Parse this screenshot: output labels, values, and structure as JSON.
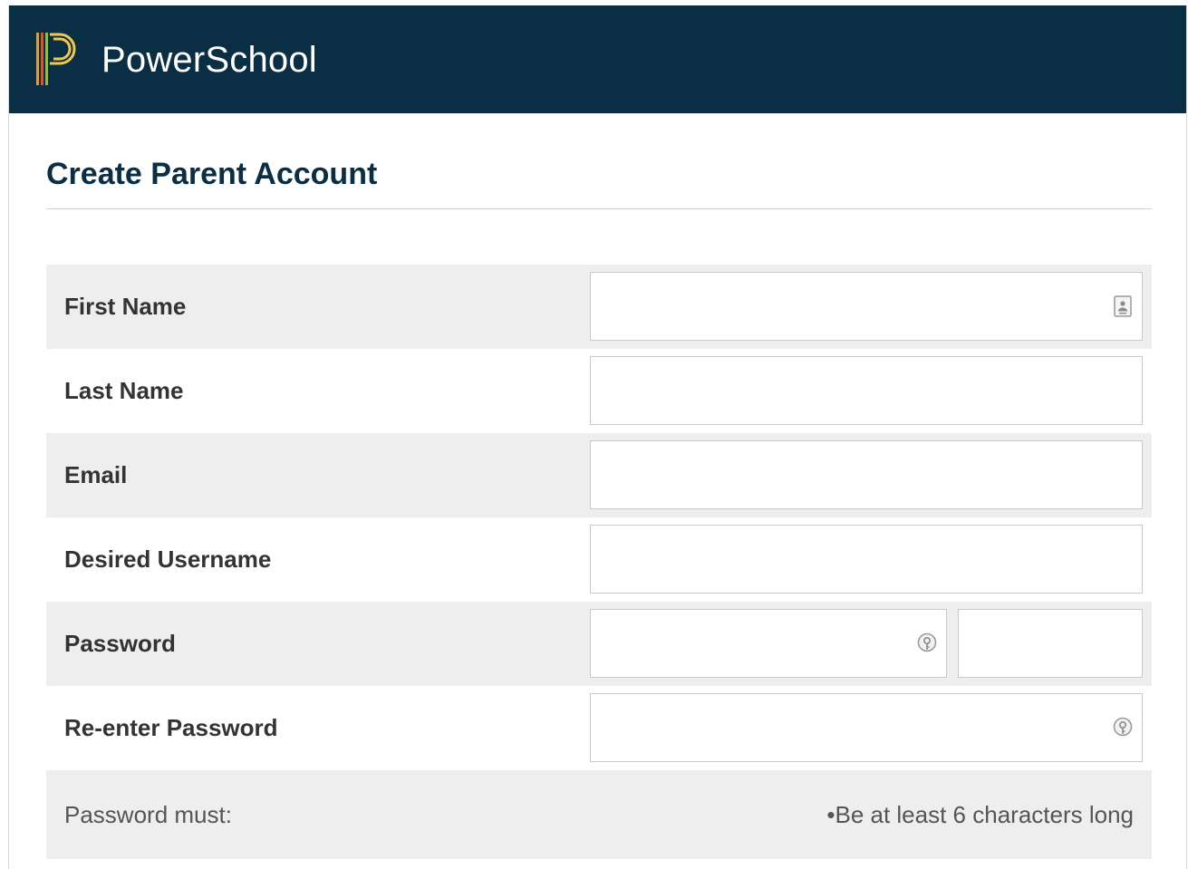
{
  "header": {
    "brand": "PowerSchool",
    "logo_icon": "powerschool-logo",
    "background_color": "#0a2f45"
  },
  "page": {
    "title": "Create Parent Account"
  },
  "form": {
    "first_name": {
      "label": "First Name",
      "value": "",
      "icon": "contact-card-icon"
    },
    "last_name": {
      "label": "Last Name",
      "value": ""
    },
    "email": {
      "label": "Email",
      "value": ""
    },
    "username": {
      "label": "Desired Username",
      "value": ""
    },
    "password": {
      "label": "Password",
      "value": "",
      "icon": "password-key-icon",
      "strength_value": ""
    },
    "reenter_password": {
      "label": "Re-enter Password",
      "value": "",
      "icon": "password-key-icon"
    },
    "requirements": {
      "label": "Password must:",
      "rule": "•Be at least 6 characters long"
    }
  },
  "colors": {
    "accent": "#0a2f45",
    "row_shade": "#eeeeee",
    "label_text": "#333333"
  }
}
